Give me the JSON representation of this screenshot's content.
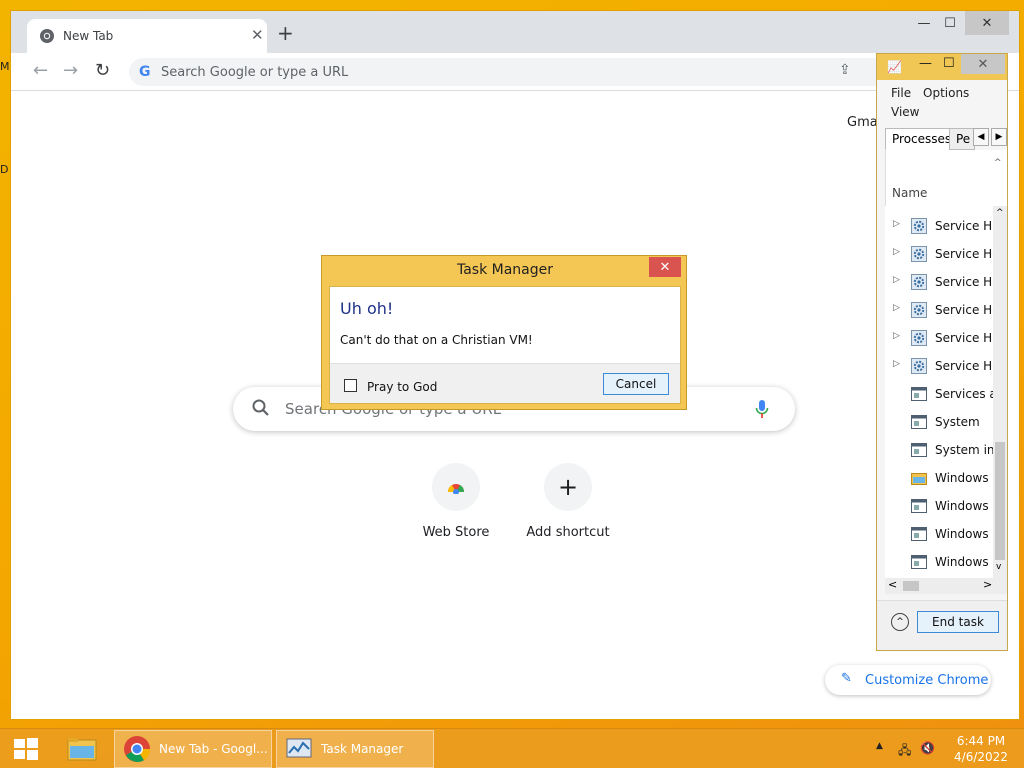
{
  "desktop": {
    "edge_glyphs": [
      "M",
      "D"
    ]
  },
  "chrome": {
    "tab": {
      "title": "New Tab",
      "close": "✕"
    },
    "new_tab": "+",
    "window_controls": {
      "minimize": "—",
      "maximize": "☐",
      "close": "✕"
    },
    "omnibox": {
      "placeholder": "Search Google or type a URL"
    },
    "gmail_link": "Gmai",
    "search": {
      "placeholder": "Search Google or type a URL"
    },
    "shortcuts": [
      {
        "label": "Web Store",
        "icon": "chrome-web-store-icon"
      },
      {
        "label": "Add shortcut",
        "icon": "plus-icon",
        "glyph": "+"
      }
    ],
    "customize_button": "Customize Chrome"
  },
  "task_manager": {
    "menu": [
      "File",
      "Options",
      "View"
    ],
    "tabs": [
      "Processes",
      "Pe"
    ],
    "column_name": "Name",
    "rows": [
      {
        "name": "Service Ho",
        "expandable": true,
        "icon": "gear-icon"
      },
      {
        "name": "Service Ho",
        "expandable": true,
        "icon": "gear-icon"
      },
      {
        "name": "Service Ho",
        "expandable": true,
        "icon": "gear-icon"
      },
      {
        "name": "Service Ho",
        "expandable": true,
        "icon": "gear-icon"
      },
      {
        "name": "Service Ho",
        "expandable": true,
        "icon": "gear-icon"
      },
      {
        "name": "Service Ho",
        "expandable": true,
        "icon": "gear-icon"
      },
      {
        "name": "Services ar",
        "expandable": false,
        "icon": "window-icon"
      },
      {
        "name": "System",
        "expandable": false,
        "icon": "window-icon"
      },
      {
        "name": "System int",
        "expandable": false,
        "icon": "window-icon"
      },
      {
        "name": "Windows E",
        "expandable": false,
        "icon": "folder-icon"
      },
      {
        "name": "Windows L",
        "expandable": false,
        "icon": "window-icon"
      },
      {
        "name": "Windows S",
        "expandable": false,
        "icon": "window-icon"
      },
      {
        "name": "Windows S",
        "expandable": false,
        "icon": "window-icon"
      }
    ],
    "end_task": "End task"
  },
  "dialog": {
    "title": "Task Manager",
    "heading": "Uh oh!",
    "message": "Can't do that on a Christian VM!",
    "checkbox_label": "Pray to God",
    "cancel": "Cancel"
  },
  "taskbar": {
    "chrome_label": "New Tab - Googl...",
    "task_manager_label": "Task Manager",
    "time": "6:44 PM",
    "date": "4/6/2022"
  }
}
